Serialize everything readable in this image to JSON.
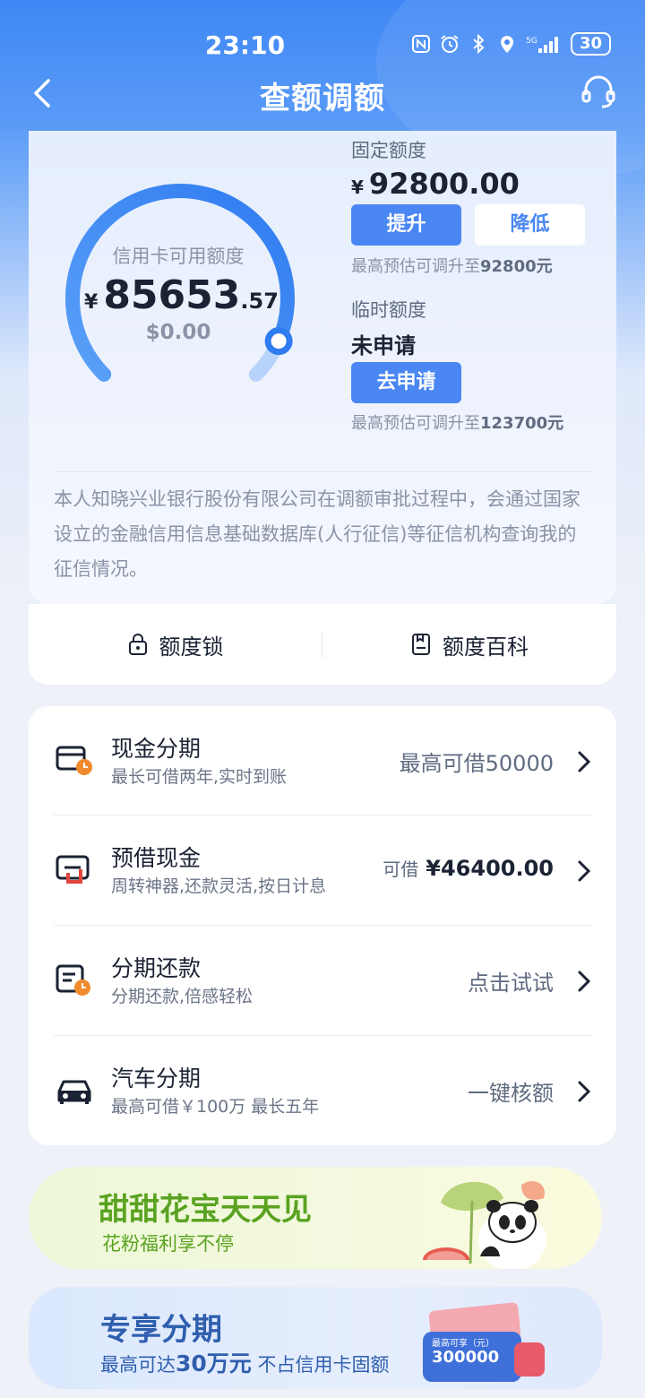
{
  "status_bar": {
    "time": "23:10",
    "network": "5G",
    "battery": "30"
  },
  "nav": {
    "title": "查额调额",
    "back_icon": "back-arrow-icon",
    "support_icon": "headset-icon"
  },
  "credit": {
    "gauge_label": "信用卡可用额度",
    "currency": "¥",
    "available_integer": "85653",
    "available_decimal": ".57",
    "usd": "$0.00",
    "gauge_fraction": 0.92,
    "accent_color": "#4a87f3"
  },
  "fixed": {
    "label": "固定额度",
    "currency": "¥",
    "amount": "92800.00",
    "raise_label": "提升",
    "lower_label": "降低",
    "hint_prefix": "最高预估可调升至",
    "hint_value": "92800元"
  },
  "temporary": {
    "label": "临时额度",
    "status": "未申请",
    "apply_label": "去申请",
    "hint_prefix": "最高预估可调升至",
    "hint_value": "123700元"
  },
  "notice": "本人知晓兴业银行股份有限公司在调额审批过程中，会通过国家设立的金融信用信息基础数据库(人行征信)等征信机构查询我的征信情况。",
  "quick": {
    "lock_label": "额度锁",
    "wiki_label": "额度百科"
  },
  "products": [
    {
      "title": "现金分期",
      "subtitle": "最长可借两年,实时到账",
      "right": "最高可借50000"
    },
    {
      "title": "预借现金",
      "subtitle": "周转神器,还款灵活,按日计息",
      "right_prefix": "可借",
      "right_amount": "¥46400.00"
    },
    {
      "title": "分期还款",
      "subtitle": "分期还款,倍感轻松",
      "right": "点击试试"
    },
    {
      "title": "汽车分期",
      "subtitle": "最高可借￥100万 最长五年",
      "right": "一键核额"
    }
  ],
  "banner1": {
    "title": "甜甜花宝天天见",
    "subtitle": "花粉福利享不停"
  },
  "banner2": {
    "title": "专享分期",
    "sub_prefix": "最高可达",
    "sub_highlight": "30万元",
    "sub_suffix": " 不占信用卡固额",
    "card_label": "最高可享（元）",
    "card_value": "300000"
  }
}
